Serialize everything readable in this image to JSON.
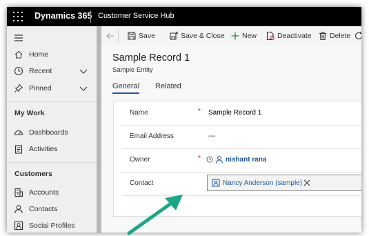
{
  "topbar": {
    "app_name": "Dynamics 365",
    "hub_name": "Customer Service Hub"
  },
  "sidebar": {
    "items": [
      {
        "label": "Home",
        "icon": "home-icon"
      },
      {
        "label": "Recent",
        "icon": "clock-icon"
      },
      {
        "label": "Pinned",
        "icon": "pin-icon"
      }
    ],
    "sections": [
      {
        "title": "My Work",
        "items": [
          {
            "label": "Dashboards",
            "icon": "dashboard-icon"
          },
          {
            "label": "Activities",
            "icon": "activities-icon"
          }
        ]
      },
      {
        "title": "Customers",
        "items": [
          {
            "label": "Accounts",
            "icon": "accounts-icon"
          },
          {
            "label": "Contacts",
            "icon": "contact-icon"
          },
          {
            "label": "Social Profiles",
            "icon": "social-profile-icon"
          }
        ]
      }
    ]
  },
  "commandbar": {
    "save": "Save",
    "save_close": "Save & Close",
    "new": "New",
    "deactivate": "Deactivate",
    "delete": "Delete"
  },
  "record": {
    "title": "Sample Record 1",
    "entity": "Sample Entity"
  },
  "tabs": [
    "General",
    "Related"
  ],
  "form": {
    "fields": [
      {
        "label": "Name",
        "required": "*",
        "value": "Sample Record 1"
      },
      {
        "label": "Email Address",
        "value": "---"
      },
      {
        "label": "Owner",
        "required": "*",
        "value": "nishant rana"
      },
      {
        "label": "Contact",
        "value": "Nancy Anderson (sample)"
      }
    ]
  },
  "colors": {
    "topbar": "#000000",
    "link": "#1d5a9c",
    "required": "#a4262c",
    "annotation_arrow": "#1aa785"
  }
}
